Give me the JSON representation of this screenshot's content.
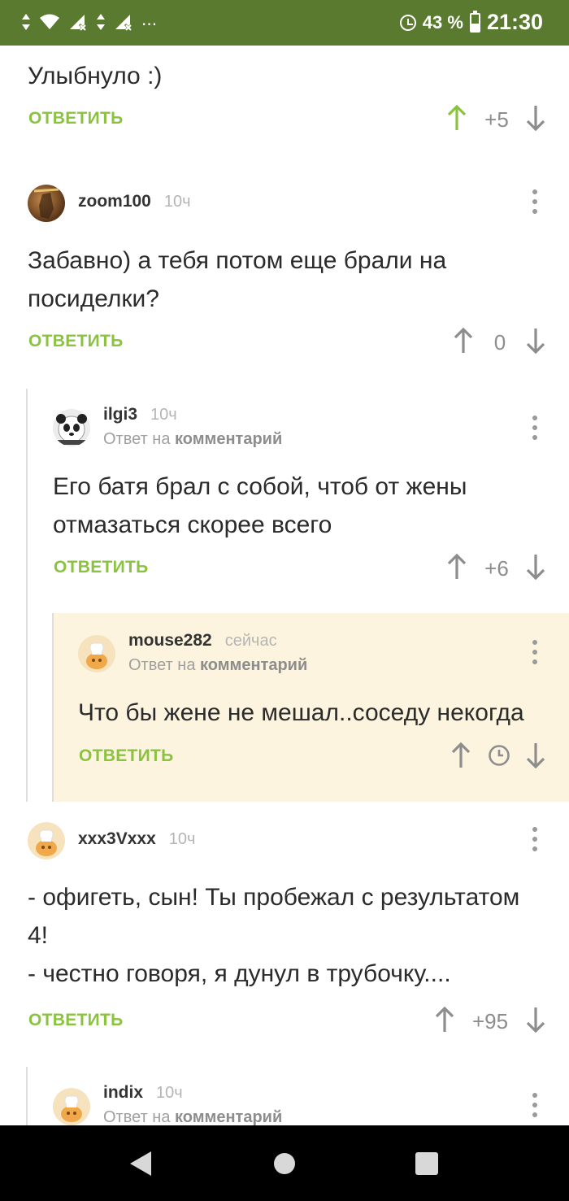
{
  "status_bar": {
    "left_icons": [
      "data-arrows-icon",
      "wifi-icon",
      "signal-x-icon",
      "data-arrows-icon",
      "signal-x-icon",
      "more-icon"
    ],
    "more": "···",
    "battery_percent": "43 %",
    "battery_level": 0.43,
    "time": "21:30"
  },
  "comments": [
    {
      "text": "Улыбнуло :)",
      "reply_label": "ОТВЕТИТЬ",
      "score": "+5",
      "upvoted": true
    },
    {
      "username": "zoom100",
      "time": "10ч",
      "text_lines": [
        "Забавно) а тебя потом еще брали на",
        "посиделки?"
      ],
      "reply_label": "ОТВЕТИТЬ",
      "score": "0"
    },
    {
      "username": "ilgi3",
      "time": "10ч",
      "reply_to_prefix": "Ответ на",
      "reply_to_target": "комментарий",
      "text_lines": [
        "Его батя брал с собой, чтоб от жены",
        "отмазаться скорее всего"
      ],
      "reply_label": "ОТВЕТИТЬ",
      "score": "+6"
    },
    {
      "username": "mouse282",
      "time": "сейчас",
      "reply_to_prefix": "Ответ на",
      "reply_to_target": "комментарий",
      "text_lines": [
        "Что бы жене не мешал..соседу некогда"
      ],
      "reply_label": "ОТВЕТИТЬ",
      "score_icon": "clock-icon",
      "highlighted": true
    },
    {
      "username": "xxx3Vxxx",
      "time": "10ч",
      "text_lines": [
        "- офигеть, сын! Ты пробежал с результатом",
        "4!",
        "- честно говоря, я дунул в трубочку...."
      ],
      "reply_label": "ОТВЕТИТЬ",
      "score": "+95"
    },
    {
      "username": "indix",
      "time": "10ч",
      "reply_to_prefix": "Ответ на",
      "reply_to_target": "комментарий"
    }
  ],
  "colors": {
    "status_bar": "#5a7a30",
    "reply_green": "#8ac33f",
    "highlight_bg": "#fcf4de",
    "nav_bar": "#000000"
  },
  "nav_bar": {
    "buttons": [
      "back-icon",
      "home-icon",
      "recents-icon"
    ]
  }
}
